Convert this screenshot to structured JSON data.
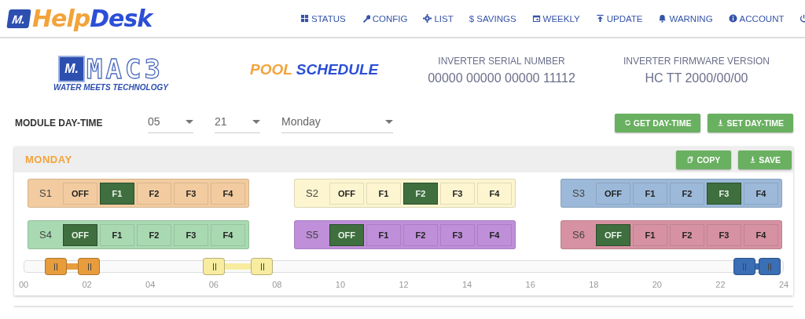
{
  "header": {
    "logo": {
      "mark": "M.",
      "word_1": "Help",
      "word_2": "Desk"
    },
    "nav": [
      {
        "kind": "grid",
        "label": "STATUS"
      },
      {
        "kind": "wrench",
        "label": "CONFIG"
      },
      {
        "kind": "gear",
        "label": "LIST"
      },
      {
        "kind": "symbol",
        "symbol": "$",
        "label": "SAVINGS"
      },
      {
        "kind": "calendar",
        "label": "WEEKLY"
      },
      {
        "kind": "upload",
        "label": "UPDATE"
      },
      {
        "kind": "bell",
        "label": "WARNING"
      },
      {
        "kind": "info",
        "label": "ACCOUNT"
      },
      {
        "kind": "power"
      }
    ]
  },
  "info": {
    "brand": {
      "mark": "M.",
      "name": "MAC3",
      "tagline": "WATER MEETS TECHNOLOGY"
    },
    "title": {
      "part_1": "POOL",
      "part_2": "SCHEDULE"
    },
    "fields": [
      {
        "label": "INVERTER SERIAL NUMBER",
        "value": "00000 00000 00000 11112"
      },
      {
        "label": "INVERTER FIRMWARE VERSION",
        "value": "HC TT 2000/00/00"
      }
    ]
  },
  "day_time": {
    "label": "MODULE DAY-TIME",
    "selects": [
      {
        "value": "05"
      },
      {
        "value": "21"
      },
      {
        "value": "Monday"
      }
    ],
    "buttons": [
      {
        "kind": "refresh",
        "label": "GET DAY-TIME"
      },
      {
        "kind": "download",
        "label": "SET DAY-TIME"
      }
    ]
  },
  "schedule": {
    "day": "MONDAY",
    "buttons": [
      {
        "kind": "copy",
        "label": "COPY"
      },
      {
        "kind": "download",
        "label": "SAVE"
      }
    ],
    "groups": [
      {
        "name": "S1",
        "color": "#f2cca0",
        "options": [
          {
            "label": "OFF",
            "selected": false
          },
          {
            "label": "F1",
            "selected": true
          },
          {
            "label": "F2",
            "selected": false
          },
          {
            "label": "F3",
            "selected": false
          },
          {
            "label": "F4",
            "selected": false
          }
        ]
      },
      {
        "name": "S2",
        "color": "#fcf5cf",
        "options": [
          {
            "label": "OFF",
            "selected": false
          },
          {
            "label": "F1",
            "selected": false
          },
          {
            "label": "F2",
            "selected": true
          },
          {
            "label": "F3",
            "selected": false
          },
          {
            "label": "F4",
            "selected": false
          }
        ]
      },
      {
        "name": "S3",
        "color": "#9cb9d9",
        "options": [
          {
            "label": "OFF",
            "selected": false
          },
          {
            "label": "F1",
            "selected": false
          },
          {
            "label": "F2",
            "selected": false
          },
          {
            "label": "F3",
            "selected": true
          },
          {
            "label": "F4",
            "selected": false
          }
        ]
      },
      {
        "name": "S4",
        "color": "#a9d9b1",
        "options": [
          {
            "label": "OFF",
            "selected": true
          },
          {
            "label": "F1",
            "selected": false
          },
          {
            "label": "F2",
            "selected": false
          },
          {
            "label": "F3",
            "selected": false
          },
          {
            "label": "F4",
            "selected": false
          }
        ]
      },
      {
        "name": "S5",
        "color": "#bf8fd9",
        "options": [
          {
            "label": "OFF",
            "selected": true
          },
          {
            "label": "F1",
            "selected": false
          },
          {
            "label": "F2",
            "selected": false
          },
          {
            "label": "F3",
            "selected": false
          },
          {
            "label": "F4",
            "selected": false
          }
        ]
      },
      {
        "name": "S6",
        "color": "#d692a2",
        "options": [
          {
            "label": "OFF",
            "selected": true
          },
          {
            "label": "F1",
            "selected": false
          },
          {
            "label": "F2",
            "selected": false
          },
          {
            "label": "F3",
            "selected": false
          },
          {
            "label": "F4",
            "selected": false
          }
        ]
      }
    ],
    "timeline": {
      "ranges": [
        {
          "color": "#e89c3c",
          "handles": [
            {
              "level": 0.041
            },
            {
              "level": 0.085
            }
          ]
        },
        {
          "color": "#f7eca0",
          "handles": [
            {
              "level": 0.25
            },
            {
              "level": 0.313
            }
          ]
        },
        {
          "color": "#3a6eb5",
          "handles": [
            {
              "level": 0.949
            },
            {
              "level": 0.982
            }
          ]
        }
      ],
      "ticks": [
        "00",
        "02",
        "04",
        "06",
        "08",
        "10",
        "12",
        "14",
        "16",
        "18",
        "20",
        "22",
        "24"
      ]
    }
  }
}
